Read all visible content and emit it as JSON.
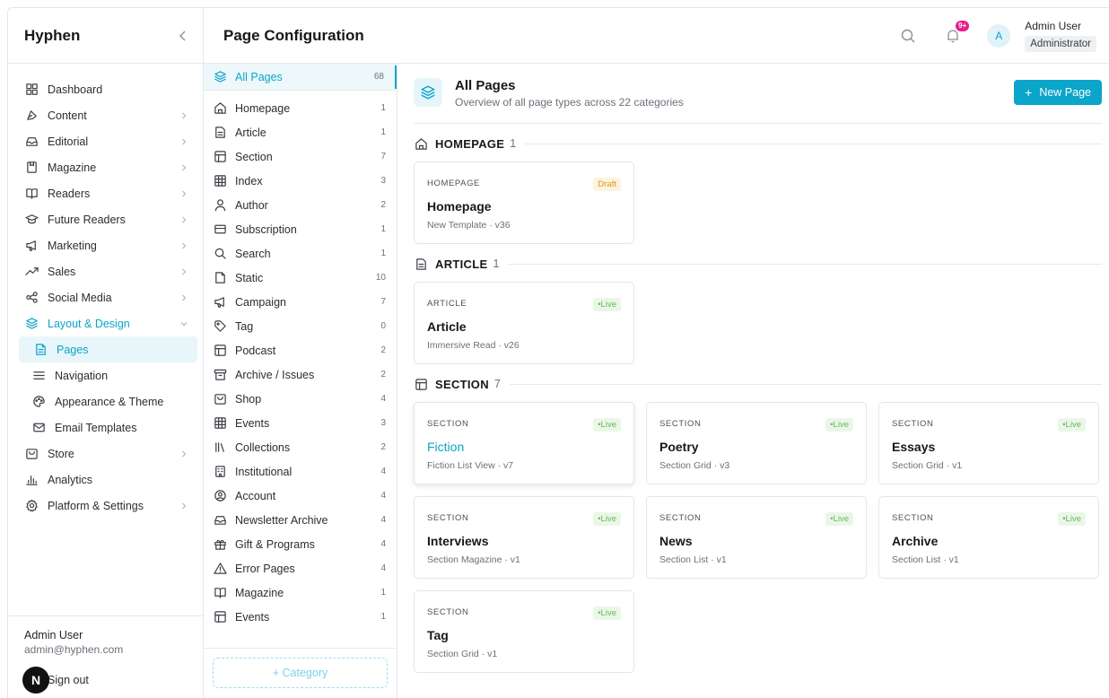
{
  "sidebar": {
    "brand": "Hyphen",
    "items": [
      {
        "label": "Dashboard",
        "icon": "dashboard-icon"
      },
      {
        "label": "Content",
        "icon": "content-icon",
        "chevron": true
      },
      {
        "label": "Editorial",
        "icon": "editorial-icon",
        "chevron": true
      },
      {
        "label": "Magazine",
        "icon": "magazine-icon",
        "chevron": true
      },
      {
        "label": "Readers",
        "icon": "book-icon",
        "chevron": true
      },
      {
        "label": "Future Readers",
        "icon": "graduation-icon",
        "chevron": true
      },
      {
        "label": "Marketing",
        "icon": "megaphone-icon",
        "chevron": true
      },
      {
        "label": "Sales",
        "icon": "trend-icon",
        "chevron": true
      },
      {
        "label": "Social Media",
        "icon": "share-icon",
        "chevron": true
      },
      {
        "label": "Layout & Design",
        "icon": "layers-icon",
        "chevron": true,
        "expanded": true
      },
      {
        "label": "Pages",
        "icon": "page-icon",
        "sub": true,
        "selected": true
      },
      {
        "label": "Navigation",
        "icon": "menu-icon",
        "sub": true
      },
      {
        "label": "Appearance & Theme",
        "icon": "palette-icon",
        "sub": true
      },
      {
        "label": "Email Templates",
        "icon": "mail-icon",
        "sub": true
      },
      {
        "label": "Store",
        "icon": "store-icon",
        "chevron": true
      },
      {
        "label": "Analytics",
        "icon": "analytics-icon"
      },
      {
        "label": "Platform & Settings",
        "icon": "gear-icon",
        "chevron": true
      }
    ],
    "footer": {
      "name": "Admin User",
      "email": "admin@hyphen.com",
      "badge": "N",
      "signout": "Sign out"
    }
  },
  "topbar": {
    "title": "Page Configuration",
    "notification_badge": "9+",
    "avatar_initial": "A",
    "user_name": "Admin User",
    "user_role": "Administrator"
  },
  "categories": {
    "all": {
      "label": "All Pages",
      "count": "68"
    },
    "items": [
      {
        "label": "Homepage",
        "count": "1",
        "icon": "home-icon"
      },
      {
        "label": "Article",
        "count": "1",
        "icon": "article-icon"
      },
      {
        "label": "Section",
        "count": "7",
        "icon": "section-icon"
      },
      {
        "label": "Index",
        "count": "3",
        "icon": "grid-icon"
      },
      {
        "label": "Author",
        "count": "2",
        "icon": "user-icon"
      },
      {
        "label": "Subscription",
        "count": "1",
        "icon": "card-icon"
      },
      {
        "label": "Search",
        "count": "1",
        "icon": "search-icon"
      },
      {
        "label": "Static",
        "count": "10",
        "icon": "file-icon"
      },
      {
        "label": "Campaign",
        "count": "7",
        "icon": "megaphone-icon"
      },
      {
        "label": "Tag",
        "count": "0",
        "icon": "tag-icon"
      },
      {
        "label": "Podcast",
        "count": "2",
        "icon": "section-icon"
      },
      {
        "label": "Archive / Issues",
        "count": "2",
        "icon": "archive-icon"
      },
      {
        "label": "Shop",
        "count": "4",
        "icon": "store-icon"
      },
      {
        "label": "Events",
        "count": "3",
        "icon": "grid-icon"
      },
      {
        "label": "Collections",
        "count": "2",
        "icon": "library-icon"
      },
      {
        "label": "Institutional",
        "count": "4",
        "icon": "building-icon"
      },
      {
        "label": "Account",
        "count": "4",
        "icon": "account-icon"
      },
      {
        "label": "Newsletter Archive",
        "count": "4",
        "icon": "inbox-icon"
      },
      {
        "label": "Gift & Programs",
        "count": "4",
        "icon": "gift-icon"
      },
      {
        "label": "Error Pages",
        "count": "4",
        "icon": "warning-icon"
      },
      {
        "label": "Magazine",
        "count": "1",
        "icon": "book-icon"
      },
      {
        "label": "Events",
        "count": "1",
        "icon": "section-icon"
      }
    ],
    "add_label": "+ Category"
  },
  "content": {
    "title": "All Pages",
    "subtitle": "Overview of all page types across 22 categories",
    "new_button": "New Page",
    "groups": [
      {
        "title": "HOMEPAGE",
        "count": "1",
        "icon": "home-icon",
        "cards": [
          {
            "type": "HOMEPAGE",
            "status": "Draft",
            "name": "Homepage",
            "meta": "New Template · v36"
          }
        ]
      },
      {
        "title": "ARTICLE",
        "count": "1",
        "icon": "article-icon",
        "cards": [
          {
            "type": "ARTICLE",
            "status": "•Live",
            "name": "Article",
            "meta": "Immersive Read · v26"
          }
        ]
      },
      {
        "title": "SECTION",
        "count": "7",
        "icon": "section-icon",
        "cards": [
          {
            "type": "SECTION",
            "status": "•Live",
            "name": "Fiction",
            "meta": "Fiction List View · v7",
            "hover": true
          },
          {
            "type": "SECTION",
            "status": "•Live",
            "name": "Poetry",
            "meta": "Section Grid · v3"
          },
          {
            "type": "SECTION",
            "status": "•Live",
            "name": "Essays",
            "meta": "Section Grid · v1"
          },
          {
            "type": "SECTION",
            "status": "•Live",
            "name": "Interviews",
            "meta": "Section Magazine · v1"
          },
          {
            "type": "SECTION",
            "status": "•Live",
            "name": "News",
            "meta": "Section List · v1"
          },
          {
            "type": "SECTION",
            "status": "•Live",
            "name": "Archive",
            "meta": "Section List · v1"
          },
          {
            "type": "SECTION",
            "status": "•Live",
            "name": "Tag",
            "meta": "Section Grid · v1"
          }
        ]
      }
    ]
  },
  "colors": {
    "accent": "#0aa5c9",
    "live": "#69b85c",
    "draft": "#d89b1c",
    "badge": "#e91e8c"
  }
}
